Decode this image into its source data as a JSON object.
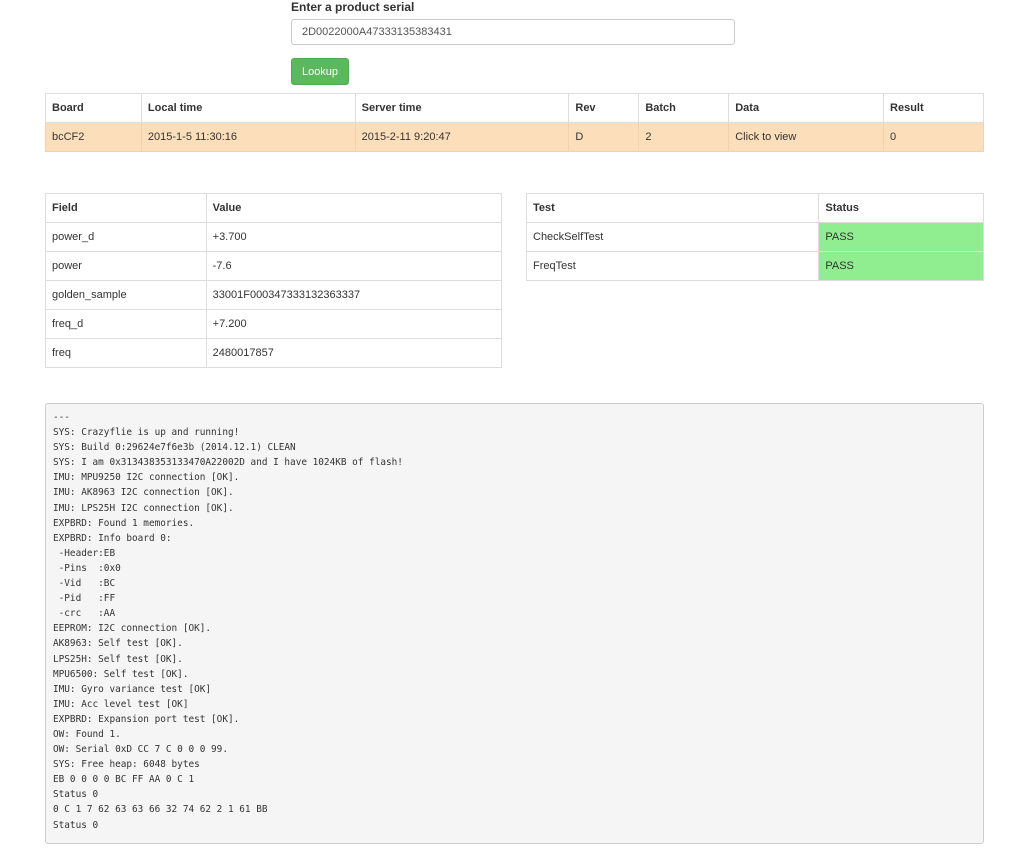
{
  "lookup": {
    "label": "Enter a product serial",
    "serial_value": "2D0022000A47333135383431",
    "button_label": "Lookup"
  },
  "board_table": {
    "headers": [
      "Board",
      "Local time",
      "Server time",
      "Rev",
      "Batch",
      "Data",
      "Result"
    ],
    "row": {
      "board": "bcCF2",
      "local_time": "2015-1-5 11:30:16",
      "server_time": "2015-2-11 9:20:47",
      "rev": "D",
      "batch": "2",
      "data": "Click to view",
      "result": "0"
    }
  },
  "fields_table": {
    "headers": [
      "Field",
      "Value"
    ],
    "rows": [
      {
        "field": "power_d",
        "value": "+3.700"
      },
      {
        "field": "power",
        "value": "-7.6"
      },
      {
        "field": "golden_sample",
        "value": "33001F000347333132363337"
      },
      {
        "field": "freq_d",
        "value": "+7.200"
      },
      {
        "field": "freq",
        "value": "2480017857"
      }
    ]
  },
  "tests_table": {
    "headers": [
      "Test",
      "Status"
    ],
    "rows": [
      {
        "test": "CheckSelfTest",
        "status": "PASS"
      },
      {
        "test": "FreqTest",
        "status": "PASS"
      }
    ],
    "pass_color": "#90ee90"
  },
  "colors": {
    "lookup_button": "#5cb85c",
    "board_row": "#fcdfba",
    "log_background": "#f5f5f5"
  },
  "console_log": "---\nSYS: Crazyflie is up and running!\nSYS: Build 0:29624e7f6e3b (2014.12.1) CLEAN\nSYS: I am 0x313438353133470A22002D and I have 1024KB of flash!\nIMU: MPU9250 I2C connection [OK].\nIMU: AK8963 I2C connection [OK].\nIMU: LPS25H I2C connection [OK].\nEXPBRD: Found 1 memories.\nEXPBRD: Info board 0:\n -Header:EB\n -Pins  :0x0\n -Vid   :BC\n -Pid   :FF\n -crc   :AA\nEEPROM: I2C connection [OK].\nAK8963: Self test [OK].\nLPS25H: Self test [OK].\nMPU6500: Self test [OK].\nIMU: Gyro variance test [OK]\nIMU: Acc level test [OK]\nEXPBRD: Expansion port test [OK].\nOW: Found 1.\nOW: Serial 0xD CC 7 C 0 0 0 99.\nSYS: Free heap: 6048 bytes\nEB 0 0 0 0 BC FF AA 0 C 1\nStatus 0\n0 C 1 7 62 63 63 66 32 74 62 2 1 61 BB\nStatus 0"
}
